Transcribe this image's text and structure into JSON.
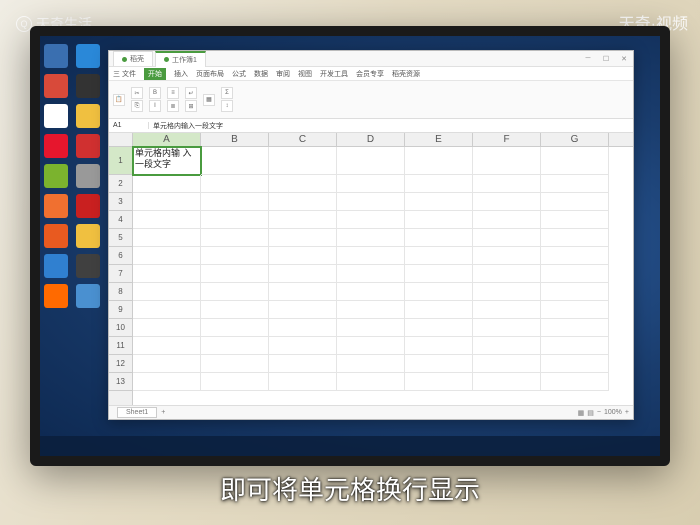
{
  "watermarks": {
    "top_left": "天奇生活",
    "top_right": "天奇·视频"
  },
  "subtitle": "即可将单元格换行显示",
  "desktop": {
    "icons": [
      {
        "name": "recycle-bin",
        "color": "#3a6fb0"
      },
      {
        "name": "app-blue",
        "color": "#2a88d8"
      },
      {
        "name": "app-red",
        "color": "#d84a3a"
      },
      {
        "name": "app-dark",
        "color": "#333"
      },
      {
        "name": "qq",
        "color": "#fff"
      },
      {
        "name": "folder",
        "color": "#f0c040"
      },
      {
        "name": "weibo",
        "color": "#e6162d"
      },
      {
        "name": "app-red2",
        "color": "#d03030"
      },
      {
        "name": "wechat",
        "color": "#7bb32e"
      },
      {
        "name": "app-gray",
        "color": "#999"
      },
      {
        "name": "app-orange",
        "color": "#f07030"
      },
      {
        "name": "app-red3",
        "color": "#c92020"
      },
      {
        "name": "app-orange2",
        "color": "#e85a20"
      },
      {
        "name": "folder2",
        "color": "#f0c040"
      },
      {
        "name": "app-blue2",
        "color": "#3080d0"
      },
      {
        "name": "app-dark2",
        "color": "#404040"
      },
      {
        "name": "app-orange3",
        "color": "#ff6a00"
      },
      {
        "name": "app-blue3",
        "color": "#4a90d0"
      }
    ]
  },
  "app": {
    "tabs": [
      {
        "label": "稻壳",
        "color": "#4a9b3f",
        "active": false
      },
      {
        "label": "工作簿1",
        "color": "#4a9b3f",
        "active": true
      }
    ],
    "menu": [
      "三 文件",
      "开始",
      "插入",
      "页面布局",
      "公式",
      "数据",
      "审阅",
      "视图",
      "开发工具",
      "会员专享",
      "稻壳资源"
    ],
    "active_menu": "开始",
    "formula": {
      "cell_ref": "A1",
      "content": "单元格内输入一段文字"
    },
    "columns": [
      "A",
      "B",
      "C",
      "D",
      "E",
      "F",
      "G"
    ],
    "rows": [
      "1",
      "2",
      "3",
      "4",
      "5",
      "6",
      "7",
      "8",
      "9",
      "10",
      "11",
      "12",
      "13"
    ],
    "active_cell": {
      "row": 0,
      "col": 0,
      "text": "单元格内输\n入一段文字"
    },
    "sheet_tab": "Sheet1",
    "zoom": "100%"
  }
}
